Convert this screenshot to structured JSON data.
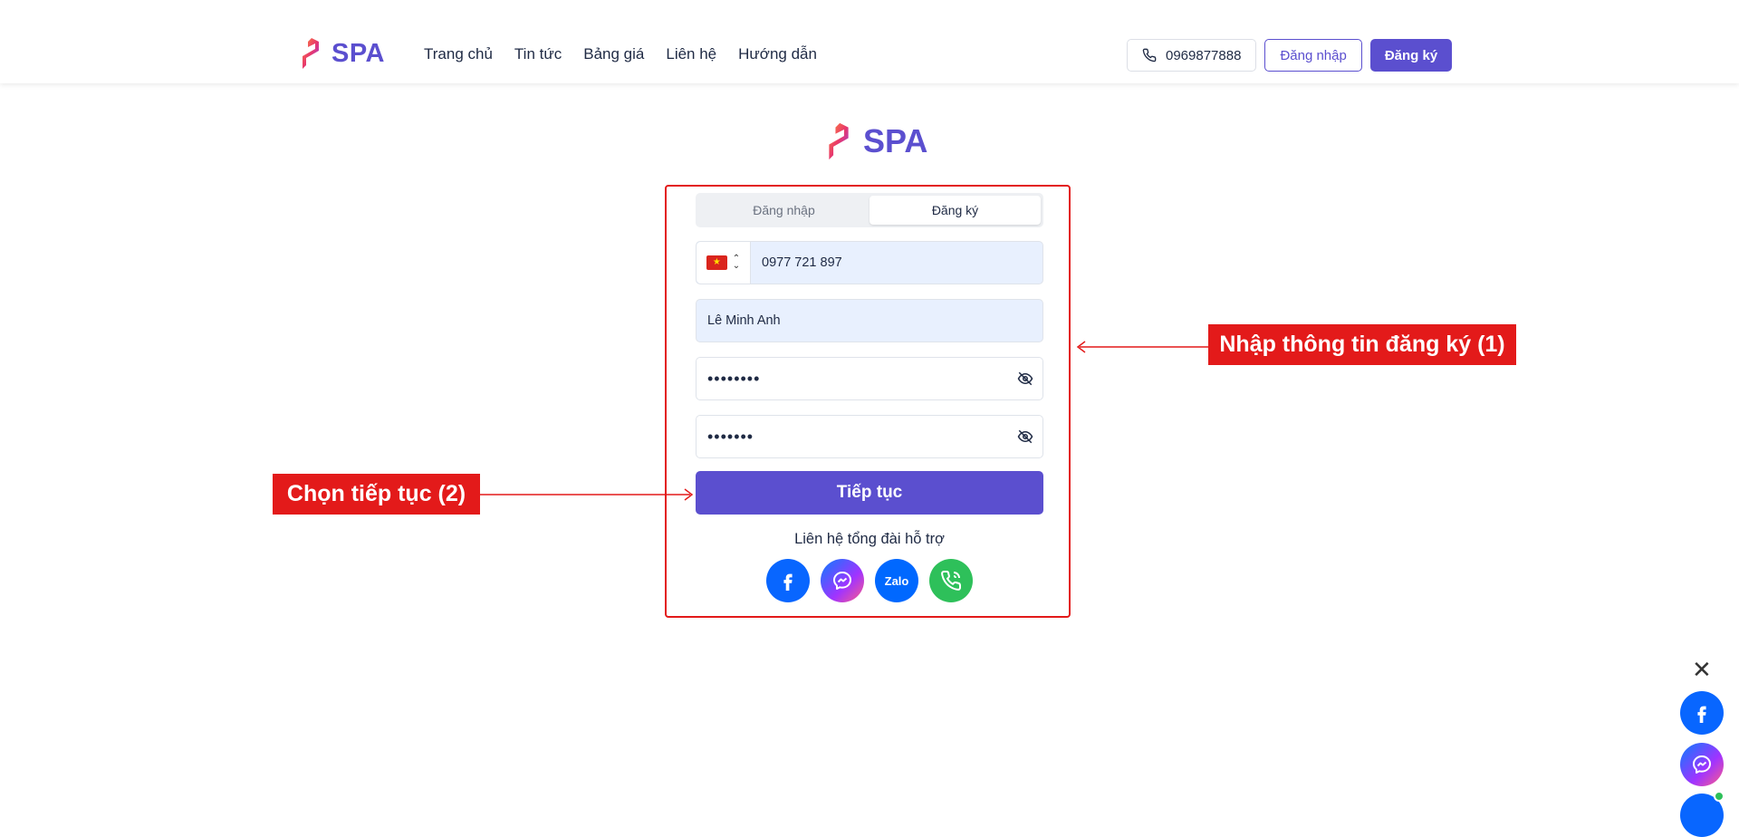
{
  "header": {
    "brand_name": "SPA",
    "nav": [
      "Trang chủ",
      "Tin tức",
      "Bảng giá",
      "Liên hệ",
      "Hướng dẫn"
    ],
    "phone": "0969877888",
    "login_label": "Đăng nhập",
    "register_label": "Đăng ký"
  },
  "center_brand": {
    "name": "SPA"
  },
  "form": {
    "tabs": {
      "login": "Đăng nhập",
      "register": "Đăng ký",
      "active": "register"
    },
    "country_icon": "vietnam-flag-icon",
    "phone_value": "0977 721 897",
    "name_value": "Lê Minh Anh",
    "password_mask": "••••••••",
    "confirm_password_mask": "•••••••",
    "submit_label": "Tiếp tục",
    "support_text": "Liên hệ tổng đài hỗ trợ",
    "zalo_label": "Zalo"
  },
  "annotations": {
    "step1": "Nhập thông tin đăng ký (1)",
    "step2": "Chọn tiếp tục (2)"
  },
  "colors": {
    "accent": "#5b4fcf",
    "annotation_red": "#e31a1a",
    "facebook_blue": "#0866ff",
    "call_green": "#2ec05a"
  },
  "floating": {
    "close_icon": "close-icon"
  }
}
